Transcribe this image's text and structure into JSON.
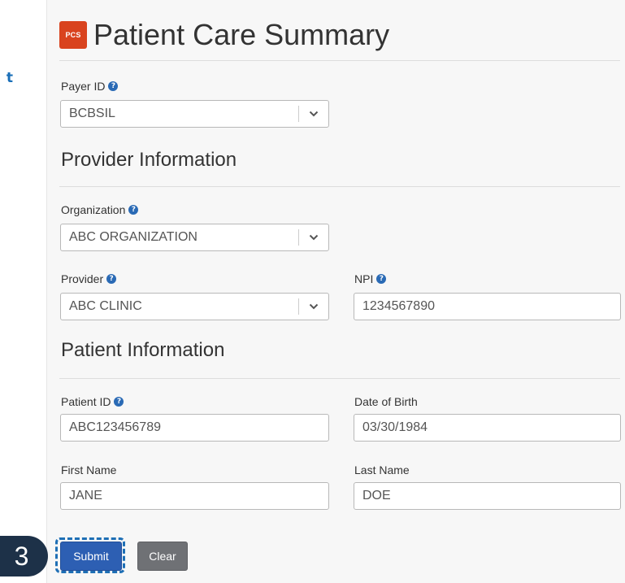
{
  "side_fragment": "t",
  "header": {
    "logo_text": "PCS",
    "title": "Patient Care Summary"
  },
  "payer": {
    "label": "Payer ID",
    "value": "BCBSIL"
  },
  "provider_section": {
    "title": "Provider Information",
    "organization": {
      "label": "Organization",
      "value": "ABC ORGANIZATION"
    },
    "provider": {
      "label": "Provider",
      "value": "ABC CLINIC"
    },
    "npi": {
      "label": "NPI",
      "value": "1234567890"
    }
  },
  "patient_section": {
    "title": "Patient Information",
    "patient_id": {
      "label": "Patient ID",
      "value": "ABC123456789"
    },
    "dob": {
      "label": "Date of Birth",
      "value": "03/30/1984"
    },
    "first_name": {
      "label": "First Name",
      "value": "JANE"
    },
    "last_name": {
      "label": "Last Name",
      "value": "DOE"
    }
  },
  "actions": {
    "submit_label": "Submit",
    "clear_label": "Clear"
  },
  "callout": {
    "step_number": "3"
  },
  "colors": {
    "logo": "#d9431e",
    "help_icon": "#2a6ab5",
    "submit": "#2d5fb3",
    "clear": "#6f7175",
    "callout_badge": "#1d3148",
    "focus_ring": "#1e6fb5"
  },
  "icons": {
    "help": "question-circle-icon",
    "dropdown": "chevron-down-icon"
  }
}
